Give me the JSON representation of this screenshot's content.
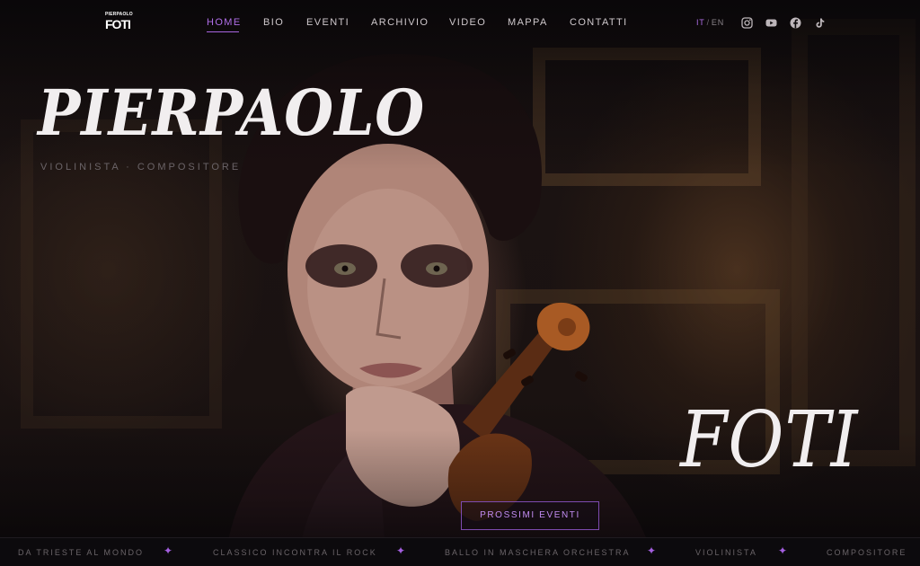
{
  "header": {
    "logo": {
      "top": "PIERPAOLO",
      "main": "FOTI"
    },
    "nav": [
      "HOME",
      "BIO",
      "EVENTI",
      "ARCHIVIO",
      "VIDEO",
      "MAPPA",
      "CONTATTI"
    ],
    "active_nav": "HOME",
    "lang": {
      "it": "IT",
      "sep": "/",
      "en": "EN",
      "active": "IT"
    },
    "social_icons": [
      "instagram-icon",
      "youtube-icon",
      "facebook-icon",
      "tiktok-icon"
    ]
  },
  "hero": {
    "first_name": "PIERPAOLO",
    "subtitle": "VIOLINISTA · COMPOSITORE",
    "last_name": "FOTI",
    "cta_label": "PROSSIMI EVENTI"
  },
  "ticker": {
    "items": [
      "DA TRIESTE AL MONDO",
      "CLASSICO INCONTRA IL ROCK",
      "BALLO IN MASCHERA ORCHESTRA",
      "VIOLINISTA",
      "COMPOSITORE"
    ],
    "separator": "✦"
  },
  "colors": {
    "accent": "#b06ee8",
    "text": "#f1eeef",
    "muted": "#6b6468",
    "background": "#0d0a0c"
  }
}
